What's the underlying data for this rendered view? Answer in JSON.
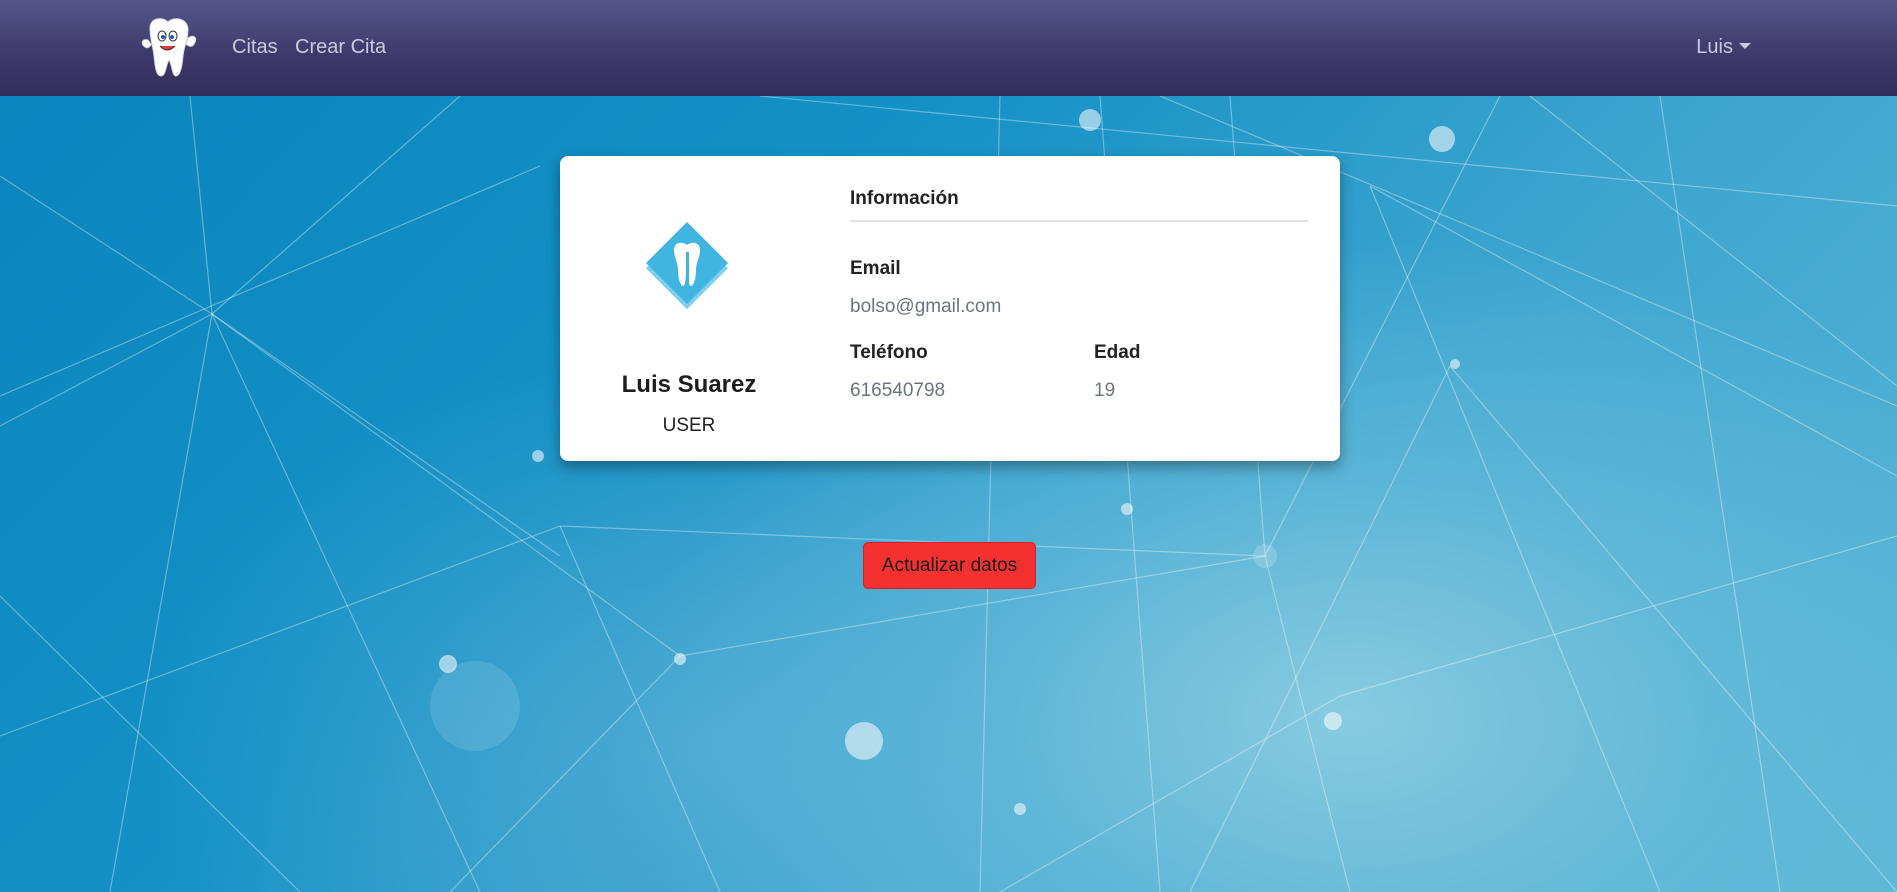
{
  "nav": {
    "brand_icon": "tooth-mascot-logo",
    "links": [
      "Citas",
      "Crear Cita"
    ],
    "user_menu_label": "Luis"
  },
  "profile": {
    "avatar_icon": "tooth-diamond-icon",
    "name": "Luis Suarez",
    "role": "USER",
    "section_title": "Información",
    "email_label": "Email",
    "email_value": "bolso@gmail.com",
    "phone_label": "Teléfono",
    "phone_value": "616540798",
    "age_label": "Edad",
    "age_value": "19"
  },
  "actions": {
    "update_label": "Actualizar datos"
  },
  "colors": {
    "navbar": "#3f3a6c",
    "background": "#1591c6",
    "button": "#f43030",
    "avatar": "#3fb5e0"
  }
}
